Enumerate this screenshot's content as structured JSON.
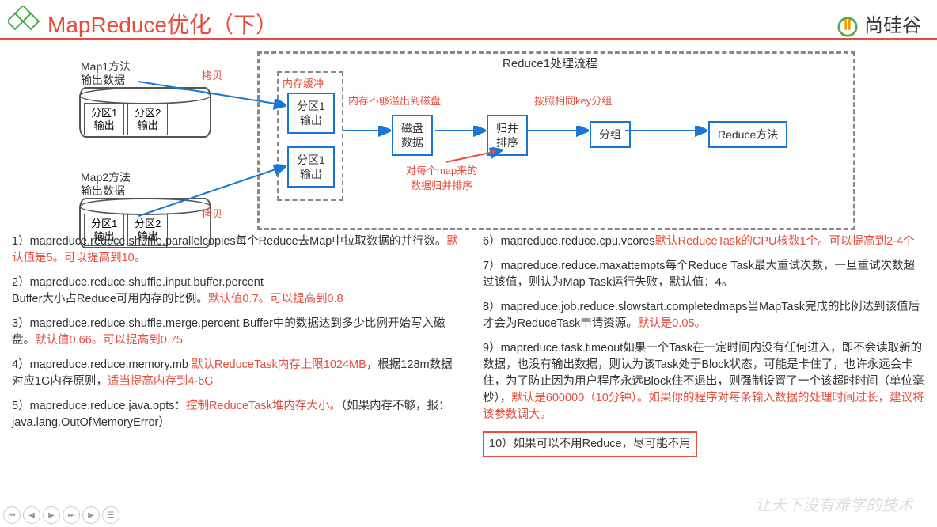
{
  "title": "MapReduce优化（下）",
  "brand": "尚硅谷",
  "diagram": {
    "map1_label": "Map1方法\n输出数据",
    "map2_label": "Map2方法\n输出数据",
    "partition1": "分区1\n输出",
    "partition2": "分区2\n输出",
    "copy_label": "拷贝",
    "reduce_flow_title": "Reduce1处理流程",
    "mem_buffer": "内存缓冲",
    "partition1_out": "分区1\n输出",
    "mem_overflow": "内存不够溢出到磁盘",
    "disk_data": "磁盘\n数据",
    "merge_sort": "归并\n排序",
    "group_by_key": "按照相同key分组",
    "group": "分组",
    "reduce_method": "Reduce方法",
    "per_map_note": "对每个map来的\n数据归并排序"
  },
  "left": {
    "p1a": "1）mapreduce.reduce.shuffle.parallelcopies每个Reduce去Map中拉取数据的并行数。",
    "p1b": "默认值是5。可以提高到10。",
    "p2a": "2）mapreduce.reduce.shuffle.input.buffer.percent",
    "p2b": "Buffer大小占Reduce可用内存的比例。",
    "p2c": "默认值0.7。可以提高到0.8",
    "p3a": "3）mapreduce.reduce.shuffle.merge.percent Buffer中的数据达到多少比例开始写入磁盘。",
    "p3b": "默认值0.66。可以提高到0.75",
    "p4a": "4）mapreduce.reduce.memory.mb ",
    "p4b": "默认ReduceTask内存上限1024MB",
    "p4c": "，根据128m数据对应1G内存原则，",
    "p4d": "适当提高内存到4-6G",
    "p5a": "5）mapreduce.reduce.java.opts：",
    "p5b": "控制ReduceTask堆内存大小。",
    "p5c": "（如果内存不够，报：java.lang.OutOfMemoryError）"
  },
  "right": {
    "p6a": "6）mapreduce.reduce.cpu.vcores",
    "p6b": "默认ReduceTask的CPU核数1个。可以提高到2-4个",
    "p7a": "7）mapreduce.reduce.maxattempts每个Reduce Task最大重试次数，一旦重试次数超过该值，则认为Map Task运行失败，默认值：4。",
    "p8a": "8）mapreduce.job.reduce.slowstart.completedmaps当MapTask完成的比例达到该值后才会为ReduceTask申请资源。",
    "p8b": "默认是0.05。",
    "p9a": "9）mapreduce.task.timeout如果一个Task在一定时间内没有任何进入，即不会读取新的数据，也没有输出数据，则认为该Task处于Block状态，可能是卡住了，也许永远会卡住，为了防止因为用户程序永远Block住不退出，则强制设置了一个该超时时间（单位毫秒），",
    "p9b": "默认是600000（10分钟）。如果你的程序对每条输入数据的处理时间过长，建议将该参数调大。",
    "p10": "10）如果可以不用Reduce，尽可能不用"
  },
  "watermark": "让天下没有难学的技术"
}
